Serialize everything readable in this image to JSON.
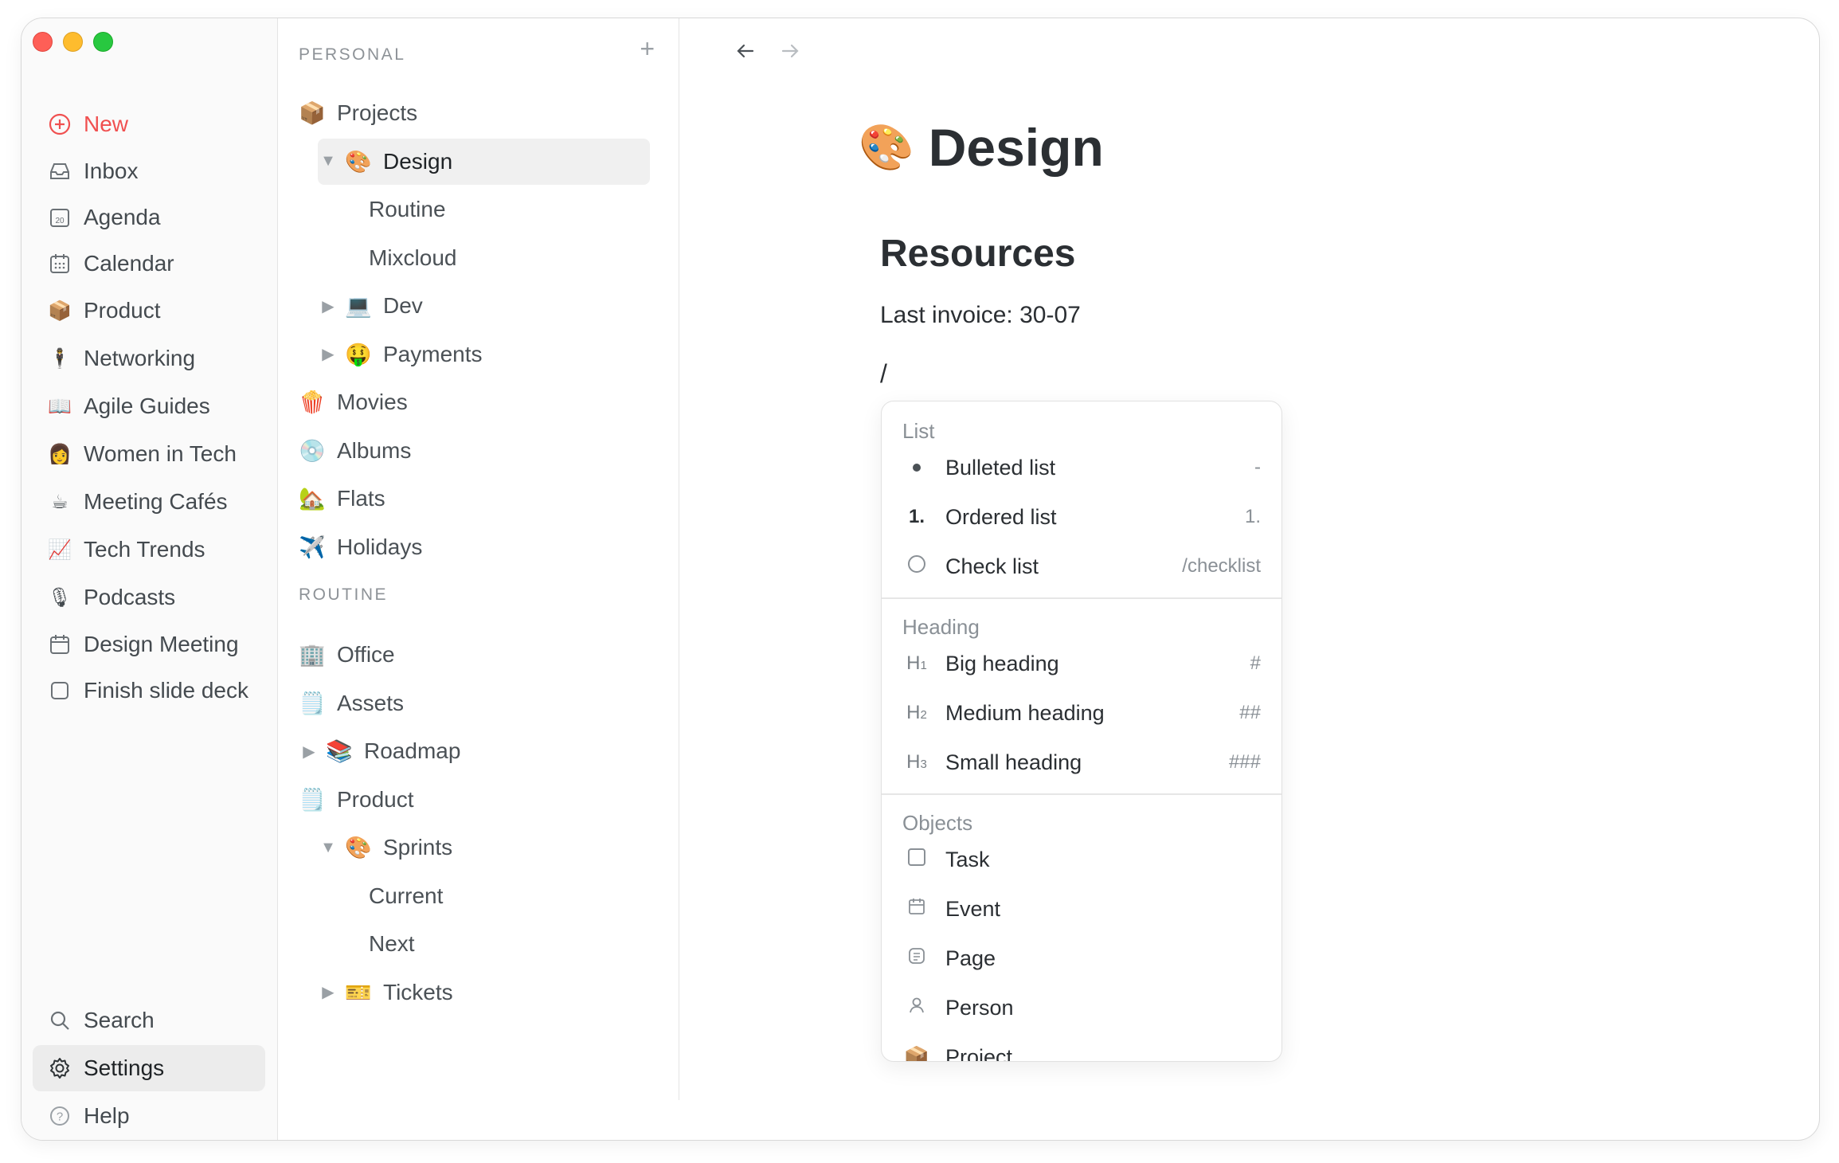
{
  "sidebar": {
    "new": "New",
    "items": [
      {
        "label": "Inbox",
        "icon": "inbox-icon"
      },
      {
        "label": "Agenda",
        "icon": "agenda-icon"
      },
      {
        "label": "Calendar",
        "icon": "calendar-icon"
      },
      {
        "label": "Product",
        "icon": "📦"
      },
      {
        "label": "Networking",
        "icon": "🕴"
      },
      {
        "label": "Agile Guides",
        "icon": "📖"
      },
      {
        "label": "Women in Tech",
        "icon": "👩"
      },
      {
        "label": "Meeting Cafés",
        "icon": "☕"
      },
      {
        "label": "Tech Trends",
        "icon": "📈"
      },
      {
        "label": "Podcasts",
        "icon": "🎙"
      },
      {
        "label": "Design Meeting",
        "icon": "calendar-icon"
      },
      {
        "label": "Finish slide deck",
        "icon": "checkbox-icon"
      }
    ],
    "agenda_icon_text": "20",
    "search": "Search",
    "settings": "Settings",
    "help": "Help"
  },
  "tree": {
    "personal_label": "PERSONAL",
    "routine_label": "ROUTINE",
    "personal": [
      {
        "label": "Projects",
        "emoji": "📦",
        "indent": 0,
        "caret": ""
      },
      {
        "label": "Design",
        "emoji": "🎨",
        "indent": 1,
        "caret": "▼",
        "selected": true
      },
      {
        "label": "Routine",
        "emoji": "",
        "indent": 2,
        "caret": ""
      },
      {
        "label": "Mixcloud",
        "emoji": "",
        "indent": 2,
        "caret": ""
      },
      {
        "label": "Dev",
        "emoji": "💻",
        "indent": 1,
        "caret": "▶"
      },
      {
        "label": "Payments",
        "emoji": "🤑",
        "indent": 1,
        "caret": "▶"
      },
      {
        "label": "Movies",
        "emoji": "🍿",
        "indent": 0,
        "caret": ""
      },
      {
        "label": "Albums",
        "emoji": "💿",
        "indent": 0,
        "caret": ""
      },
      {
        "label": "Flats",
        "emoji": "🏡",
        "indent": 0,
        "caret": ""
      },
      {
        "label": "Holidays",
        "emoji": "✈️",
        "indent": 0,
        "caret": ""
      }
    ],
    "routine": [
      {
        "label": "Office",
        "emoji": "🏢",
        "indent": 0,
        "caret": ""
      },
      {
        "label": "Assets",
        "emoji": "🗒️",
        "indent": 0,
        "caret": ""
      },
      {
        "label": "Roadmap",
        "emoji": "📚",
        "indent": 0,
        "caret": "▶"
      },
      {
        "label": "Product",
        "emoji": "🗒️",
        "indent": 0,
        "caret": ""
      },
      {
        "label": "Sprints",
        "emoji": "🎨",
        "indent": 1,
        "caret": "▼"
      },
      {
        "label": "Current",
        "emoji": "",
        "indent": 2,
        "caret": ""
      },
      {
        "label": "Next",
        "emoji": "",
        "indent": 2,
        "caret": ""
      },
      {
        "label": "Tickets",
        "emoji": "🎫",
        "indent": 1,
        "caret": "▶"
      }
    ]
  },
  "page": {
    "title": "Design",
    "title_emoji": "🎨",
    "heading": "Resources",
    "paragraph": "Last invoice: 30-07",
    "slash": "/"
  },
  "menu": {
    "groups": [
      {
        "label": "List",
        "options": [
          {
            "label": "Bulleted list",
            "shortcut": "-",
            "icon": "bullet-icon"
          },
          {
            "label": "Ordered list",
            "shortcut": "1.",
            "icon": "ordered-icon",
            "icon_text": "1."
          },
          {
            "label": "Check list",
            "shortcut": "/checklist",
            "icon": "circle-icon"
          }
        ]
      },
      {
        "label": "Heading",
        "options": [
          {
            "label": "Big heading",
            "shortcut": "#",
            "icon": "h1-icon"
          },
          {
            "label": "Medium heading",
            "shortcut": "##",
            "icon": "h2-icon"
          },
          {
            "label": "Small heading",
            "shortcut": "###",
            "icon": "h3-icon"
          }
        ]
      },
      {
        "label": "Objects",
        "options": [
          {
            "label": "Task",
            "shortcut": "",
            "icon": "checkbox-icon"
          },
          {
            "label": "Event",
            "shortcut": "",
            "icon": "calendar-icon"
          },
          {
            "label": "Page",
            "shortcut": "",
            "icon": "page-icon"
          },
          {
            "label": "Person",
            "shortcut": "",
            "icon": "person-icon"
          },
          {
            "label": "Project",
            "shortcut": "",
            "icon": "📦"
          }
        ]
      }
    ]
  }
}
